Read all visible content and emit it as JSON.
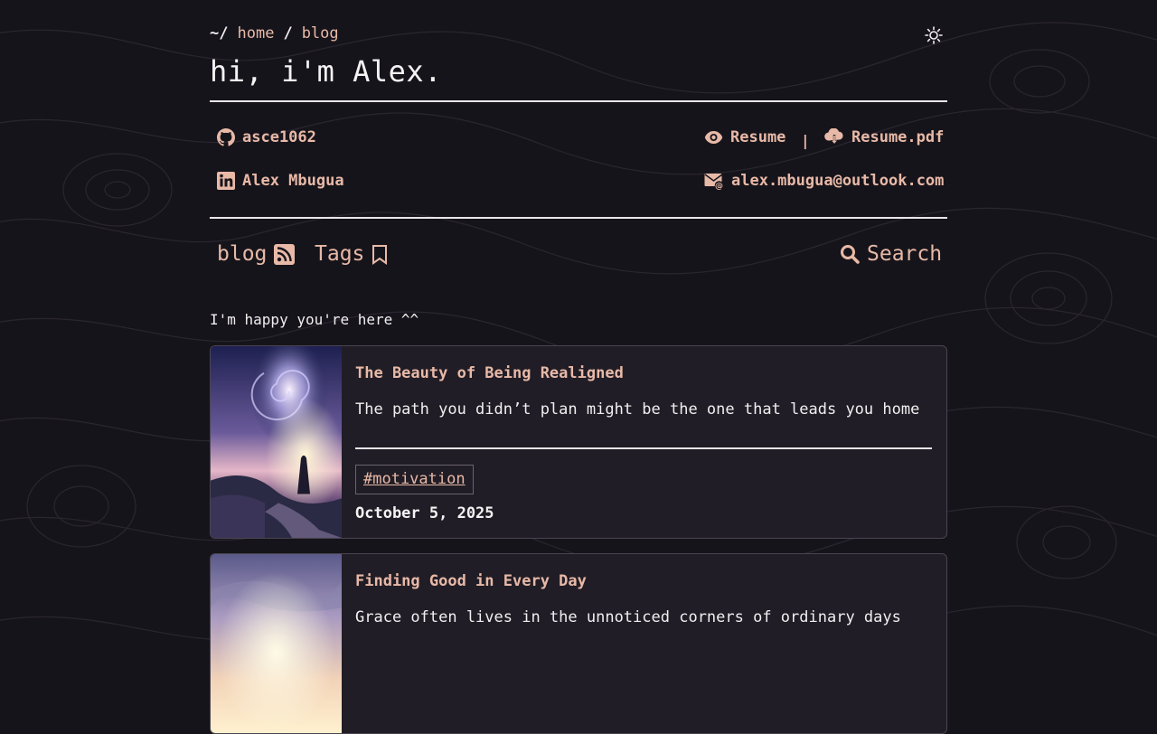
{
  "breadcrumb": {
    "prefix": "~/",
    "items": [
      "home",
      "blog"
    ],
    "separator": "/"
  },
  "theme_toggle": {
    "icon": "sun-icon"
  },
  "header": {
    "title": "hi, i'm Alex."
  },
  "links": {
    "github": {
      "icon": "github-icon",
      "label": "asce1062"
    },
    "linkedin": {
      "icon": "linkedin-icon",
      "label": "Alex Mbugua"
    },
    "resume": {
      "icon": "eye-icon",
      "label": "Resume"
    },
    "separator": "|",
    "resume_pdf": {
      "icon": "cloud-download-icon",
      "label": "Resume.pdf"
    },
    "email": {
      "icon": "envelope-at-icon",
      "label": "alex.mbugua@outlook.com"
    }
  },
  "nav": {
    "blog": {
      "label": "blog",
      "icon": "rss-icon"
    },
    "tags": {
      "label": "Tags",
      "icon": "bookmark-icon"
    },
    "search": {
      "label": "Search",
      "icon": "search-icon"
    }
  },
  "intro": "I'm happy you're here ^^",
  "posts": [
    {
      "title": "The Beauty of Being Realigned",
      "description": "The path you didn’t plan might be the one that leads you home",
      "tag": "#motivation",
      "date": "October 5, 2025"
    },
    {
      "title": "Finding Good in Every Day",
      "description": "Grace often lives in the unnoticed corners of ordinary days"
    }
  ],
  "colors": {
    "background": "#16141b",
    "accent": "#e8b9a7",
    "text": "#f2eef0",
    "card": "#211d26"
  }
}
